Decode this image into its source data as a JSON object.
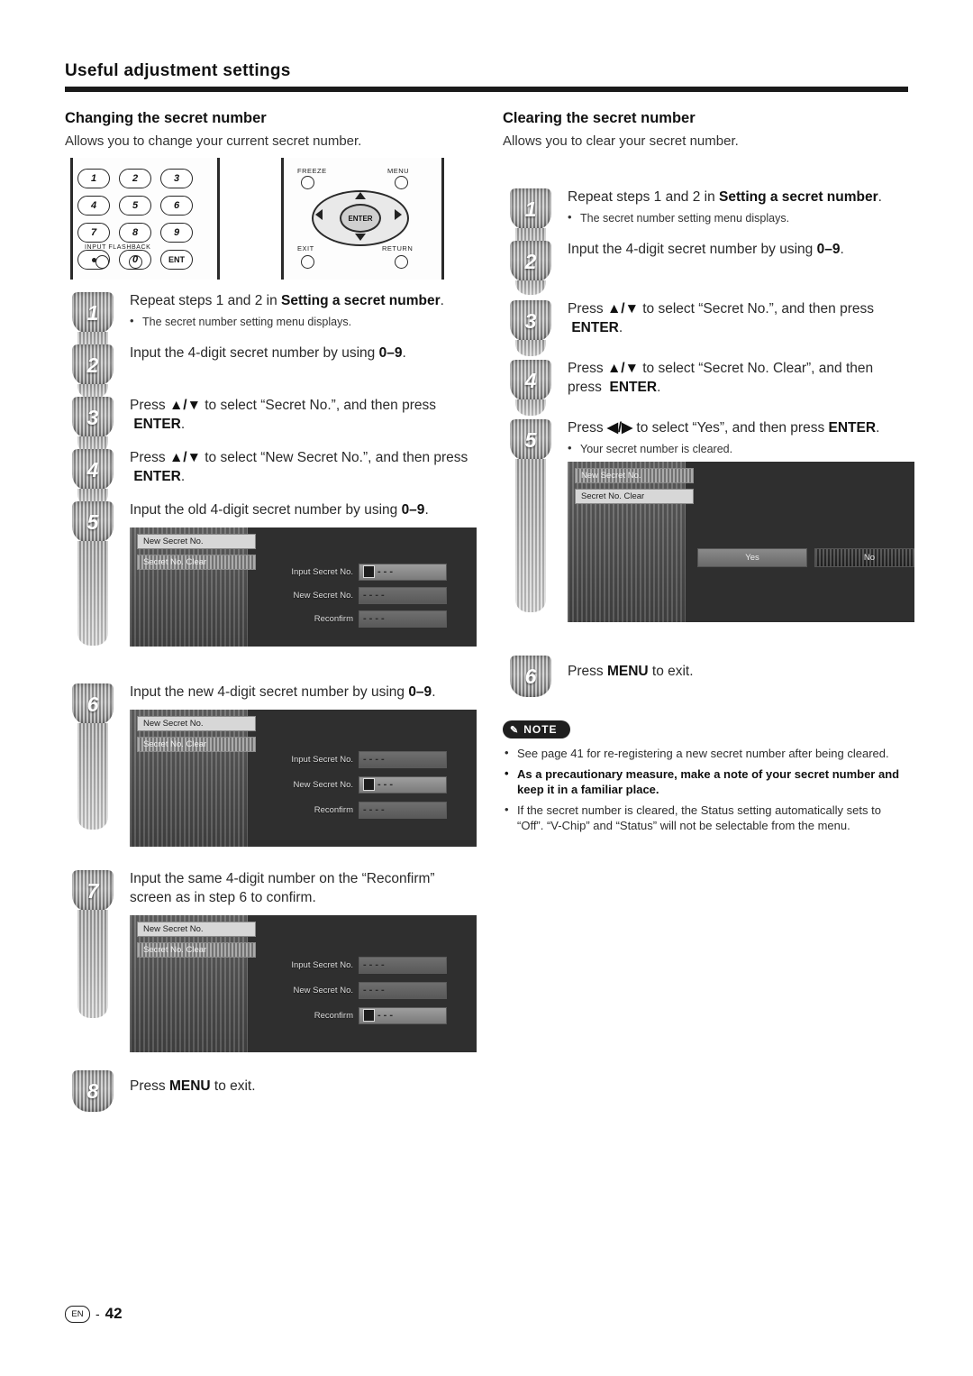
{
  "header": {
    "title": "Useful adjustment settings"
  },
  "footer": {
    "region": "EN",
    "dash": "-",
    "page": "42"
  },
  "remote": {
    "keys": [
      "1",
      "2",
      "3",
      "4",
      "5",
      "6",
      "7",
      "8",
      "9",
      "•",
      "0",
      "ENT"
    ],
    "caption": "INPUT FLASHBACK",
    "labels": {
      "freeze": "FREEZE",
      "menu": "MENU",
      "exit": "EXIT",
      "return": "RETURN",
      "enter": "ENTER"
    }
  },
  "left": {
    "title": "Changing the secret number",
    "intro": "Allows you to change your current secret number.",
    "steps": [
      {
        "num": "1",
        "text_html": "Repeat steps 1 and 2 in <b>Setting a secret number</b>.",
        "bullet": "The secret number setting menu displays."
      },
      {
        "num": "2",
        "text_html": "Input the 4-digit secret number by using <b>0–9</b>."
      },
      {
        "num": "3",
        "text_html": "Press <b>▲/▼</b> to select “Secret No.”, and then press <b>ENTER</b>."
      },
      {
        "num": "4",
        "text_html": "Press <b>▲/▼</b> to select “New Secret No.”, and then press <b>ENTER</b>."
      },
      {
        "num": "5",
        "text_html": "Input the old 4-digit secret number by using <b>0–9</b>."
      },
      {
        "num": "6",
        "text_html": "Input the new 4-digit secret number by using <b>0–9</b>."
      },
      {
        "num": "7",
        "text_html": "Input the same 4-digit number on the “Reconfirm” screen as in step 6 to confirm."
      },
      {
        "num": "8",
        "text_html": "Press <b>MENU</b> to exit."
      }
    ],
    "osd": {
      "tab_top": "New Secret No.",
      "tab_bottom": "Secret No. Clear",
      "rows": [
        "Input Secret No.",
        "New Secret No.",
        "Reconfirm"
      ]
    }
  },
  "right": {
    "title": "Clearing the secret number",
    "intro": "Allows you to clear your secret number.",
    "steps": [
      {
        "num": "1",
        "text_html": "Repeat steps 1 and 2 in <b>Setting a secret number</b>.",
        "bullet": "The secret number setting menu displays."
      },
      {
        "num": "2",
        "text_html": "Input the 4-digit secret number by using <b>0–9</b>."
      },
      {
        "num": "3",
        "text_html": "Press <b>▲/▼</b> to select “Secret No.”, and then press <b>ENTER</b>."
      },
      {
        "num": "4",
        "text_html": "Press <b>▲/▼</b> to select “Secret No. Clear”, and then press <b>ENTER</b>."
      },
      {
        "num": "5",
        "text_html": "Press <b>◀/▶</b> to select “Yes”, and then press <b>ENTER</b>.",
        "bullet": "Your secret number is cleared."
      },
      {
        "num": "6",
        "text_html": "Press <b>MENU</b> to exit."
      }
    ],
    "osd": {
      "tab_top": "New Secret No.",
      "tab_bottom": "Secret No. Clear",
      "yes": "Yes",
      "no": "No"
    },
    "note": {
      "label": "NOTE",
      "items": [
        {
          "text": "See page 41 for re-registering a new secret number after being cleared.",
          "bold": false
        },
        {
          "text": "As a precautionary measure, make a note of your secret number and keep it in a familiar place.",
          "bold": true
        },
        {
          "text": "If the secret number is cleared, the Status setting automatically sets to “Off”. “V-Chip” and “Status” will not be selectable from the menu.",
          "bold": false
        }
      ]
    }
  }
}
